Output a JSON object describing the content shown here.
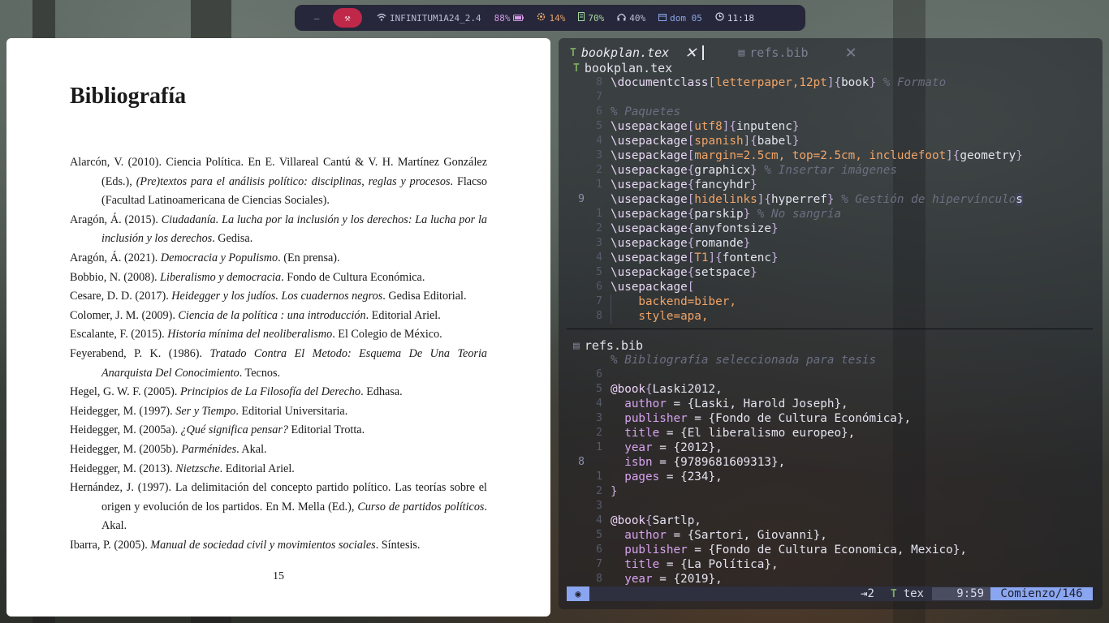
{
  "topbar": {
    "ws_inactive": "–",
    "ws_active_icon": "⚒",
    "wifi": "INFINITUM1A24_2.4",
    "battery": "88%",
    "cpu": "14%",
    "memory": "70%",
    "volume": "40%",
    "date": "dom 05",
    "time": "11:18"
  },
  "pdf": {
    "heading": "Bibliografía",
    "page_number": "15",
    "references": [
      {
        "pre": "Alarcón, V. (2010). Ciencia Política. En E. Villareal Cantú & V. H. Martínez González (Eds.), ",
        "title": "(Pre)textos para el análisis político: disciplinas, reglas y procesos",
        "post": ". Flacso (Facultad Latinoamericana de Ciencias Sociales)."
      },
      {
        "pre": "Aragón, Á. (2015). ",
        "title": "Ciudadanía. La lucha por la inclusión y los derechos: La lucha por la inclusión y los derechos",
        "post": ". Gedisa."
      },
      {
        "pre": "Aragón, Á. (2021). ",
        "title": "Democracia y Populismo",
        "post": ". (En prensa)."
      },
      {
        "pre": "Bobbio, N. (2008). ",
        "title": "Liberalismo y democracia",
        "post": ". Fondo de Cultura Económica."
      },
      {
        "pre": "Cesare, D. D. (2017). ",
        "title": "Heidegger y los judíos. Los cuadernos negros",
        "post": ". Gedisa Editorial."
      },
      {
        "pre": "Colomer, J. M. (2009). ",
        "title": "Ciencia de la política : una introducción",
        "post": ". Editorial Ariel."
      },
      {
        "pre": "Escalante, F. (2015). ",
        "title": "Historia mínima del neoliberalismo",
        "post": ". El Colegio de México."
      },
      {
        "pre": "Feyerabend, P. K. (1986). ",
        "title": "Tratado Contra El Metodo: Esquema De Una Teoria Anarquista Del Conocimiento",
        "post": ". Tecnos."
      },
      {
        "pre": "Hegel, G. W. F. (2005). ",
        "title": "Principios de La Filosofía del Derecho",
        "post": ". Edhasa."
      },
      {
        "pre": "Heidegger, M. (1997). ",
        "title": "Ser y Tiempo",
        "post": ". Editorial Universitaria."
      },
      {
        "pre": "Heidegger, M. (2005a). ",
        "title": "¿Qué significa pensar?",
        "post": " Editorial Trotta."
      },
      {
        "pre": "Heidegger, M. (2005b). ",
        "title": "Parménides",
        "post": ". Akal."
      },
      {
        "pre": "Heidegger, M. (2013). ",
        "title": "Nietzsche",
        "post": ". Editorial Ariel."
      },
      {
        "pre": "Hernández, J. (1997). La delimitación del concepto partido político. Las teorías sobre el origen y evolución de los partidos. En M. Mella (Ed.), ",
        "title": "Curso de partidos políticos",
        "post": ". Akal."
      },
      {
        "pre": "Ibarra, P. (2005). ",
        "title": "Manual de sociedad civil y movimientos sociales",
        "post": ". Síntesis."
      }
    ]
  },
  "editor": {
    "tabs": [
      {
        "label": "bookplan.tex",
        "icon": "T",
        "close": "✕"
      },
      {
        "label": "refs.bib",
        "icon": "▤",
        "close": "✕"
      }
    ],
    "pane1_file": "bookplan.tex",
    "pane1_icon": "T",
    "pane2_file": "refs.bib",
    "pane2_icon": "▤",
    "pane1_lines": [
      {
        "n": "8",
        "parts": [
          [
            "cmd",
            "\\documentclass"
          ],
          [
            "brk",
            "["
          ],
          [
            "opt",
            "letterpaper,12pt"
          ],
          [
            "brk",
            "]{"
          ],
          [
            "arg",
            "book"
          ],
          [
            "brk",
            "}"
          ],
          [
            "cmt",
            " % Formato"
          ]
        ]
      },
      {
        "n": "7",
        "parts": []
      },
      {
        "n": "6",
        "parts": [
          [
            "cmt",
            "% Paquetes"
          ]
        ]
      },
      {
        "n": "5",
        "parts": [
          [
            "cmd",
            "\\usepackage"
          ],
          [
            "brk",
            "["
          ],
          [
            "opt",
            "utf8"
          ],
          [
            "brk",
            "]{"
          ],
          [
            "arg",
            "inputenc"
          ],
          [
            "brk",
            "}"
          ]
        ]
      },
      {
        "n": "4",
        "parts": [
          [
            "cmd",
            "\\usepackage"
          ],
          [
            "brk",
            "["
          ],
          [
            "opt",
            "spanish"
          ],
          [
            "brk",
            "]{"
          ],
          [
            "arg",
            "babel"
          ],
          [
            "brk",
            "}"
          ]
        ]
      },
      {
        "n": "3",
        "parts": [
          [
            "cmd",
            "\\usepackage"
          ],
          [
            "brk",
            "["
          ],
          [
            "opt",
            "margin=2.5cm, top=2.5cm, includefoot"
          ],
          [
            "brk",
            "]{"
          ],
          [
            "arg",
            "geometry"
          ],
          [
            "brk",
            "}"
          ]
        ]
      },
      {
        "n": "2",
        "parts": [
          [
            "cmd",
            "\\usepackage"
          ],
          [
            "brk",
            "{"
          ],
          [
            "arg",
            "graphicx"
          ],
          [
            "brk",
            "}"
          ],
          [
            "cmt",
            " % Insertar imágenes"
          ]
        ]
      },
      {
        "n": "1",
        "parts": [
          [
            "cmd",
            "\\usepackage"
          ],
          [
            "brk",
            "{"
          ],
          [
            "arg",
            "fancyhdr"
          ],
          [
            "brk",
            "}"
          ]
        ]
      },
      {
        "n": "9",
        "cur": true,
        "parts": [
          [
            "cmd",
            "\\usepackage"
          ],
          [
            "brk",
            "["
          ],
          [
            "opt",
            "hidelinks"
          ],
          [
            "brk",
            "]{"
          ],
          [
            "arg",
            "hyperref"
          ],
          [
            "brk",
            "}"
          ],
          [
            "cmt",
            " % Gestión de hipervínculo"
          ],
          [
            "hlc",
            "s"
          ]
        ]
      },
      {
        "n": "1",
        "parts": [
          [
            "cmd",
            "\\usepackage"
          ],
          [
            "brk",
            "{"
          ],
          [
            "arg",
            "parskip"
          ],
          [
            "brk",
            "}"
          ],
          [
            "cmt",
            " % No sangría"
          ]
        ]
      },
      {
        "n": "2",
        "parts": [
          [
            "cmd",
            "\\usepackage"
          ],
          [
            "brk",
            "{"
          ],
          [
            "arg",
            "anyfontsize"
          ],
          [
            "brk",
            "}"
          ]
        ]
      },
      {
        "n": "3",
        "parts": [
          [
            "cmd",
            "\\usepackage"
          ],
          [
            "brk",
            "{"
          ],
          [
            "arg",
            "romande"
          ],
          [
            "brk",
            "}"
          ]
        ]
      },
      {
        "n": "4",
        "parts": [
          [
            "cmd",
            "\\usepackage"
          ],
          [
            "brk",
            "["
          ],
          [
            "opt",
            "T1"
          ],
          [
            "brk",
            "]{"
          ],
          [
            "arg",
            "fontenc"
          ],
          [
            "brk",
            "}"
          ]
        ]
      },
      {
        "n": "5",
        "parts": [
          [
            "cmd",
            "\\usepackage"
          ],
          [
            "brk",
            "{"
          ],
          [
            "arg",
            "setspace"
          ],
          [
            "brk",
            "}"
          ]
        ]
      },
      {
        "n": "6",
        "parts": [
          [
            "cmd",
            "\\usepackage"
          ],
          [
            "brk",
            "["
          ]
        ]
      },
      {
        "n": "7",
        "parts": [
          [
            "opt",
            "    backend=biber,"
          ]
        ]
      },
      {
        "n": "8",
        "parts": [
          [
            "opt",
            "    style=apa,"
          ]
        ]
      }
    ],
    "pane2_lines": [
      {
        "n": "",
        "parts": [
          [
            "cmt",
            "% Bibliografía seleccionada para tesis"
          ]
        ]
      },
      {
        "n": "6",
        "parts": []
      },
      {
        "n": "5",
        "parts": [
          [
            "kw",
            "@book"
          ],
          [
            "brk",
            "{"
          ],
          [
            "val",
            "Laski2012,"
          ]
        ]
      },
      {
        "n": "4",
        "parts": [
          [
            "val",
            "  "
          ],
          [
            "key",
            "author"
          ],
          [
            "val",
            " = {Laski, Harold Joseph},"
          ]
        ]
      },
      {
        "n": "3",
        "parts": [
          [
            "val",
            "  "
          ],
          [
            "key",
            "publisher"
          ],
          [
            "val",
            " = {Fondo de Cultura Económica},"
          ]
        ]
      },
      {
        "n": "2",
        "parts": [
          [
            "val",
            "  "
          ],
          [
            "key",
            "title"
          ],
          [
            "val",
            " = {El liberalismo europeo},"
          ]
        ]
      },
      {
        "n": "1",
        "parts": [
          [
            "val",
            "  "
          ],
          [
            "key",
            "year"
          ],
          [
            "val",
            " = {2012},"
          ]
        ]
      },
      {
        "n": "8",
        "cur": true,
        "parts": [
          [
            "val",
            "  "
          ],
          [
            "key",
            "isbn"
          ],
          [
            "val",
            " = {9789681609313},"
          ]
        ]
      },
      {
        "n": "1",
        "parts": [
          [
            "val",
            "  "
          ],
          [
            "key",
            "pages"
          ],
          [
            "val",
            " = {234},"
          ]
        ]
      },
      {
        "n": "2",
        "parts": [
          [
            "brk",
            "}"
          ]
        ]
      },
      {
        "n": "3",
        "parts": []
      },
      {
        "n": "4",
        "parts": [
          [
            "kw",
            "@book"
          ],
          [
            "brk",
            "{"
          ],
          [
            "val",
            "Sartlp,"
          ]
        ]
      },
      {
        "n": "5",
        "parts": [
          [
            "val",
            "  "
          ],
          [
            "key",
            "author"
          ],
          [
            "val",
            " = {Sartori, Giovanni},"
          ]
        ]
      },
      {
        "n": "6",
        "parts": [
          [
            "val",
            "  "
          ],
          [
            "key",
            "publisher"
          ],
          [
            "val",
            " = {Fondo de Cultura Economica, Mexico},"
          ]
        ]
      },
      {
        "n": "7",
        "parts": [
          [
            "val",
            "  "
          ],
          [
            "key",
            "title"
          ],
          [
            "val",
            " = {La Política},"
          ]
        ]
      },
      {
        "n": "8",
        "parts": [
          [
            "val",
            "  "
          ],
          [
            "key",
            "year"
          ],
          [
            "val",
            " = {2019},"
          ]
        ]
      }
    ],
    "status": {
      "mode_icon": "◉",
      "indent": "⇥2",
      "filetype_icon": "T",
      "filetype": "tex",
      "position": "9:59",
      "progress": "Comienzo/146"
    }
  }
}
